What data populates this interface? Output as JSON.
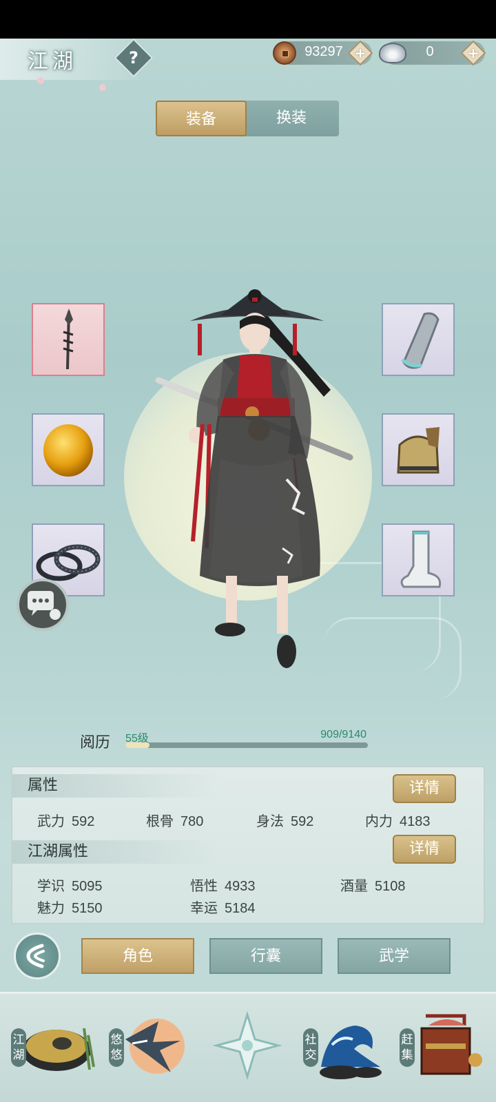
{
  "header": {
    "title": "江湖",
    "help_symbol": "?",
    "copper": {
      "value": "93297",
      "plus": "+"
    },
    "silver": {
      "value": "0",
      "plus": "+"
    }
  },
  "tabs": [
    {
      "label": "装备",
      "active": true
    },
    {
      "label": "换装",
      "active": false
    }
  ],
  "equipment": {
    "left": [
      {
        "slot": "weapon",
        "icon": "spear-icon"
      },
      {
        "slot": "gem",
        "icon": "amber-gem-icon"
      },
      {
        "slot": "bracelet",
        "icon": "bracelet-icon"
      }
    ],
    "right": [
      {
        "slot": "bracer",
        "icon": "bracer-icon"
      },
      {
        "slot": "armor",
        "icon": "armor-icon"
      },
      {
        "slot": "boots",
        "icon": "boot-icon"
      }
    ]
  },
  "experience": {
    "label": "阅历",
    "level": "55级",
    "current": 909,
    "max": 9140,
    "display": "909/9140"
  },
  "attributes": {
    "title": "属性",
    "detail_label": "详情",
    "stats": [
      {
        "name": "武力",
        "value": "592"
      },
      {
        "name": "根骨",
        "value": "780"
      },
      {
        "name": "身法",
        "value": "592"
      },
      {
        "name": "内力",
        "value": "4183"
      }
    ]
  },
  "jianghu_attributes": {
    "title": "江湖属性",
    "detail_label": "详情",
    "stats": [
      {
        "name": "学识",
        "value": "5095"
      },
      {
        "name": "悟性",
        "value": "4933"
      },
      {
        "name": "酒量",
        "value": "5108"
      },
      {
        "name": "魅力",
        "value": "5150"
      },
      {
        "name": "幸运",
        "value": "5184"
      }
    ]
  },
  "actions": [
    {
      "label": "角色",
      "active": true
    },
    {
      "label": "行囊",
      "active": false
    },
    {
      "label": "武学",
      "active": false
    }
  ],
  "bottom_nav": [
    {
      "label": "江湖",
      "icon": "bamboo-hat-icon"
    },
    {
      "label": "悠悠",
      "icon": "crane-icon"
    },
    {
      "label": "",
      "icon": "compass-star-icon"
    },
    {
      "label": "社交",
      "icon": "wave-icon"
    },
    {
      "label": "赶集",
      "icon": "basket-icon"
    }
  ],
  "colors": {
    "background": "#b4d3d1",
    "gold_button": "#cdb07a",
    "teal_button": "#8fb0ae",
    "exp_text": "#2a8a6a"
  }
}
